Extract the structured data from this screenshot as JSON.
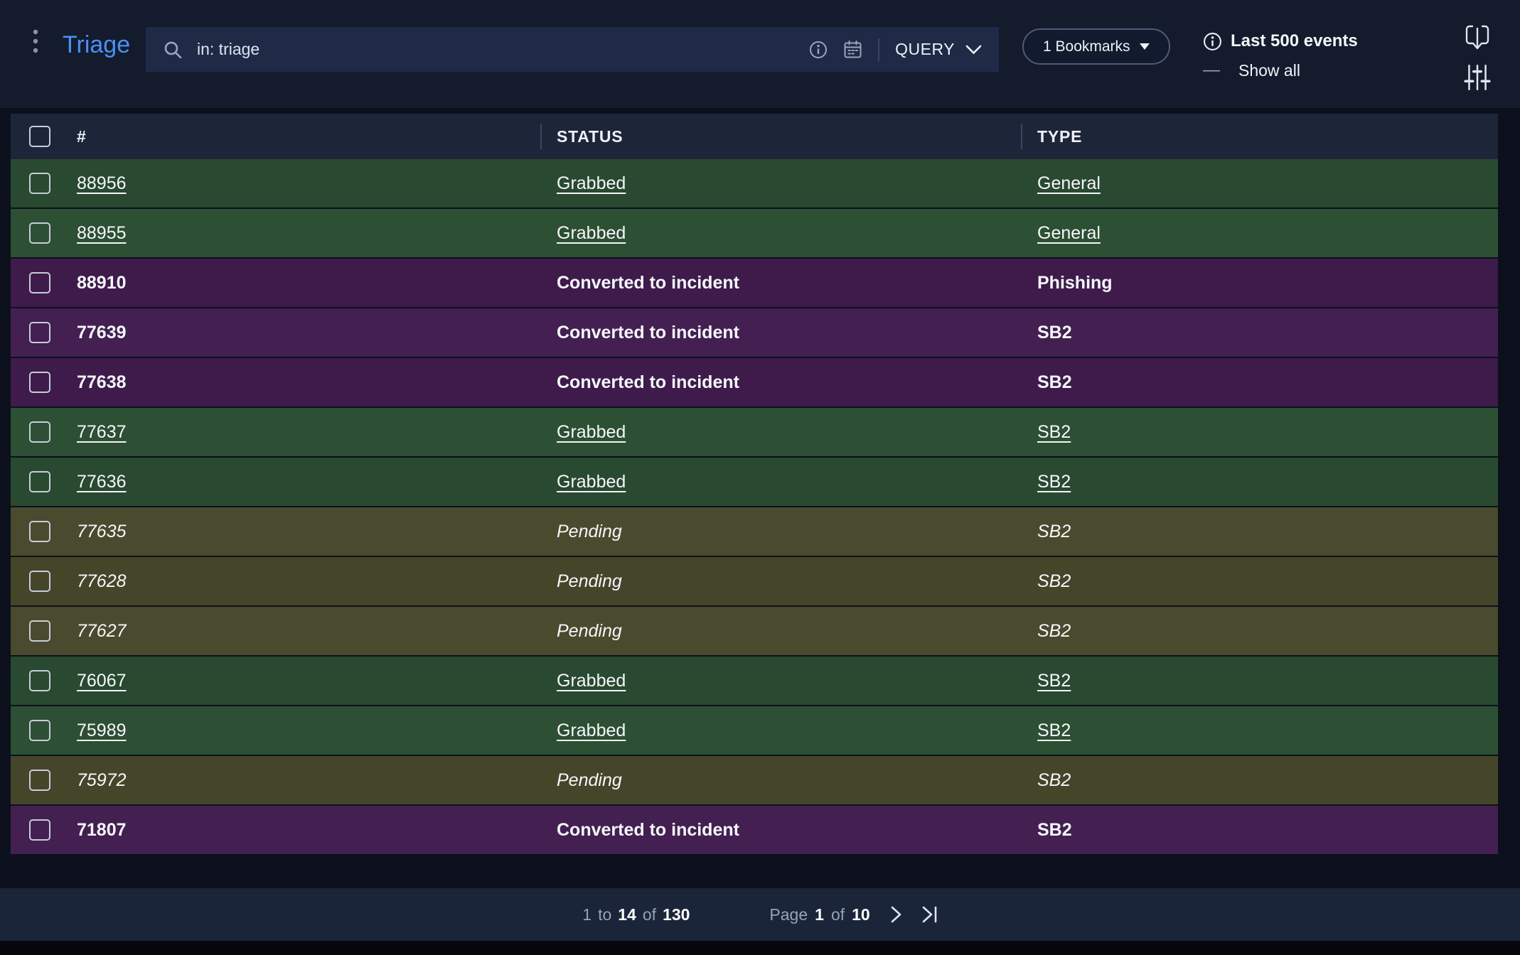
{
  "app": {
    "title": "Triage"
  },
  "search": {
    "value": "in: triage",
    "query_label": "QUERY"
  },
  "toolbar": {
    "bookmarks_label": "1 Bookmarks",
    "events_label": "Last 500 events",
    "dash": "—",
    "show_all_label": "Show all"
  },
  "table": {
    "columns": [
      "#",
      "STATUS",
      "TYPE"
    ],
    "rows": [
      {
        "id": "88956",
        "status": "Grabbed",
        "type": "General",
        "state": "grabbed"
      },
      {
        "id": "88955",
        "status": "Grabbed",
        "type": "General",
        "state": "grabbed"
      },
      {
        "id": "88910",
        "status": "Converted to incident",
        "type": "Phishing",
        "state": "converted"
      },
      {
        "id": "77639",
        "status": "Converted to incident",
        "type": "SB2",
        "state": "converted"
      },
      {
        "id": "77638",
        "status": "Converted to incident",
        "type": "SB2",
        "state": "converted"
      },
      {
        "id": "77637",
        "status": "Grabbed",
        "type": "SB2",
        "state": "grabbed"
      },
      {
        "id": "77636",
        "status": "Grabbed",
        "type": "SB2",
        "state": "grabbed"
      },
      {
        "id": "77635",
        "status": "Pending",
        "type": "SB2",
        "state": "pending"
      },
      {
        "id": "77628",
        "status": "Pending",
        "type": "SB2",
        "state": "pending"
      },
      {
        "id": "77627",
        "status": "Pending",
        "type": "SB2",
        "state": "pending"
      },
      {
        "id": "76067",
        "status": "Grabbed",
        "type": "SB2",
        "state": "grabbed"
      },
      {
        "id": "75989",
        "status": "Grabbed",
        "type": "SB2",
        "state": "grabbed"
      },
      {
        "id": "75972",
        "status": "Pending",
        "type": "SB2",
        "state": "pending"
      },
      {
        "id": "71807",
        "status": "Converted to incident",
        "type": "SB2",
        "state": "converted"
      }
    ]
  },
  "pagination": {
    "from": "1",
    "to_word": "to",
    "shown": "14",
    "of_word": "of",
    "total": "130",
    "page_word": "Page",
    "page": "1",
    "of_word2": "of",
    "pages": "10"
  },
  "icons": {
    "kebab_menu": "vertical-dots",
    "search": "magnifier",
    "info": "circled-i",
    "calendar": "calendar",
    "query_chevron": "chevron-down",
    "bookmarks_caret": "caret-down",
    "export": "panel-arrow-down",
    "filter_sliders": "vertical-sliders",
    "next_page": "chevron-right",
    "last_page": "chevron-right-bar"
  },
  "colors": {
    "accent": "#4a90f4",
    "page_bg": "#0c101d",
    "topbar_bg": "#131b2d",
    "search_bg": "#1f2a47",
    "header_bg": "#1d2539",
    "footer_bg": "#1b2539",
    "row_grabbed": "#294930",
    "row_grabbed_alt": "#2d4f34",
    "row_converted": "#3e1b4b",
    "row_converted_alt": "#432051",
    "row_pending": "#45452a",
    "row_pending_alt": "#4a4a2e",
    "text": "#f2f5fa",
    "muted": "#98a1b5"
  }
}
